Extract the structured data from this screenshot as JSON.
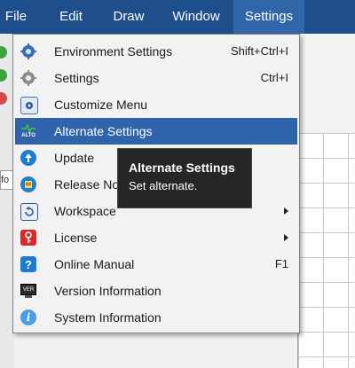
{
  "menubar": {
    "items": [
      "File",
      "Edit",
      "Draw",
      "Window",
      "Settings"
    ],
    "active": "Settings"
  },
  "background": {
    "field_text": "fo"
  },
  "menu": {
    "items": [
      {
        "label": "Environment Settings",
        "shortcut": "Shift+Ctrl+I",
        "icon": "gear-blue-icon"
      },
      {
        "label": "Settings",
        "shortcut": "Ctrl+I",
        "icon": "gear-gray-icon"
      },
      {
        "label": "Customize Menu",
        "shortcut": "",
        "icon": "customize-menu-icon"
      },
      {
        "label": "Alternate Settings",
        "shortcut": "",
        "icon": "alto-icon",
        "icon_text": "ALTO"
      },
      {
        "label": "Update",
        "shortcut": "",
        "icon": "update-globe-icon"
      },
      {
        "label": "Release Not",
        "shortcut": "",
        "icon": "release-notes-icon"
      },
      {
        "label": "Workspace",
        "shortcut": "",
        "icon": "workspace-icon",
        "submenu": true
      },
      {
        "label": "License",
        "shortcut": "",
        "icon": "license-key-icon",
        "submenu": true
      },
      {
        "label": "Online Manual",
        "shortcut": "F1",
        "icon": "help-icon"
      },
      {
        "label": "Version Information",
        "shortcut": "",
        "icon": "version-monitor-icon",
        "icon_text": "VER"
      },
      {
        "label": "System Information",
        "shortcut": "",
        "icon": "info-icon"
      }
    ],
    "highlighted_index": 3
  },
  "tooltip": {
    "title": "Alternate Settings",
    "body": "Set alternate."
  },
  "colors": {
    "menubar": "#1f4e8c",
    "menubar_active": "#3166a8",
    "highlight": "#2f64ab",
    "tooltip_bg": "#262626"
  }
}
